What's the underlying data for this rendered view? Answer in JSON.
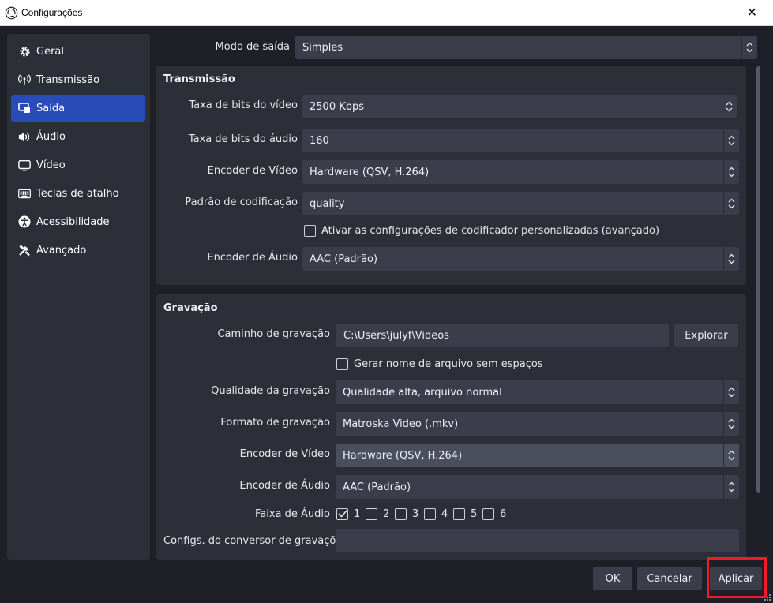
{
  "window": {
    "title": "Configurações"
  },
  "sidebar": {
    "items": [
      {
        "label": "Geral",
        "icon": "gear-icon",
        "active": false
      },
      {
        "label": "Transmissão",
        "icon": "broadcast-icon",
        "active": false
      },
      {
        "label": "Saída",
        "icon": "output-icon",
        "active": true
      },
      {
        "label": "Áudio",
        "icon": "speaker-icon",
        "active": false
      },
      {
        "label": "Vídeo",
        "icon": "monitor-icon",
        "active": false
      },
      {
        "label": "Teclas de atalho",
        "icon": "keyboard-icon",
        "active": false
      },
      {
        "label": "Acessibilidade",
        "icon": "accessibility-icon",
        "active": false
      },
      {
        "label": "Avançado",
        "icon": "tools-icon",
        "active": false
      }
    ]
  },
  "output_mode": {
    "label": "Modo de saída",
    "value": "Simples"
  },
  "streaming": {
    "title": "Transmissão",
    "video_bitrate": {
      "label": "Taxa de bits do vídeo",
      "value": "2500 Kbps"
    },
    "audio_bitrate": {
      "label": "Taxa de bits do áudio",
      "value": "160"
    },
    "video_encoder": {
      "label": "Encoder de Vídeo",
      "value": "Hardware (QSV, H.264)"
    },
    "encoder_preset": {
      "label": "Padrão de codificação",
      "value": "quality"
    },
    "custom_encoder": {
      "label": "Ativar as configurações de codificador personalizadas (avançado)",
      "checked": false
    },
    "audio_encoder": {
      "label": "Encoder de Áudio",
      "value": "AAC (Padrão)"
    }
  },
  "recording": {
    "title": "Gravação",
    "path": {
      "label": "Caminho de gravação",
      "value": "C:\\Users\\julyf\\Videos",
      "browse_label": "Explorar"
    },
    "no_spaces": {
      "label": "Gerar nome de arquivo sem espaços",
      "checked": false
    },
    "quality": {
      "label": "Qualidade da gravação",
      "value": "Qualidade alta, arquivo normal"
    },
    "format": {
      "label": "Formato de gravação",
      "value": "Matroska Video (.mkv)"
    },
    "video_encoder": {
      "label": "Encoder de Vídeo",
      "value": "Hardware (QSV, H.264)"
    },
    "audio_encoder": {
      "label": "Encoder de Áudio",
      "value": "AAC (Padrão)"
    },
    "audio_tracks": {
      "label": "Faixa de Áudio",
      "tracks": [
        {
          "label": "1",
          "checked": true
        },
        {
          "label": "2",
          "checked": false
        },
        {
          "label": "3",
          "checked": false
        },
        {
          "label": "4",
          "checked": false
        },
        {
          "label": "5",
          "checked": false
        },
        {
          "label": "6",
          "checked": false
        }
      ]
    },
    "muxer": {
      "label": "Configs. do conversor de gravações",
      "value": ""
    }
  },
  "footer": {
    "ok_label": "OK",
    "cancel_label": "Cancelar",
    "apply_label": "Aplicar"
  },
  "colors": {
    "accent": "#284cb8",
    "highlight_border": "#ee1c25",
    "panel": "#2c2e38",
    "background": "#1e1f27"
  }
}
